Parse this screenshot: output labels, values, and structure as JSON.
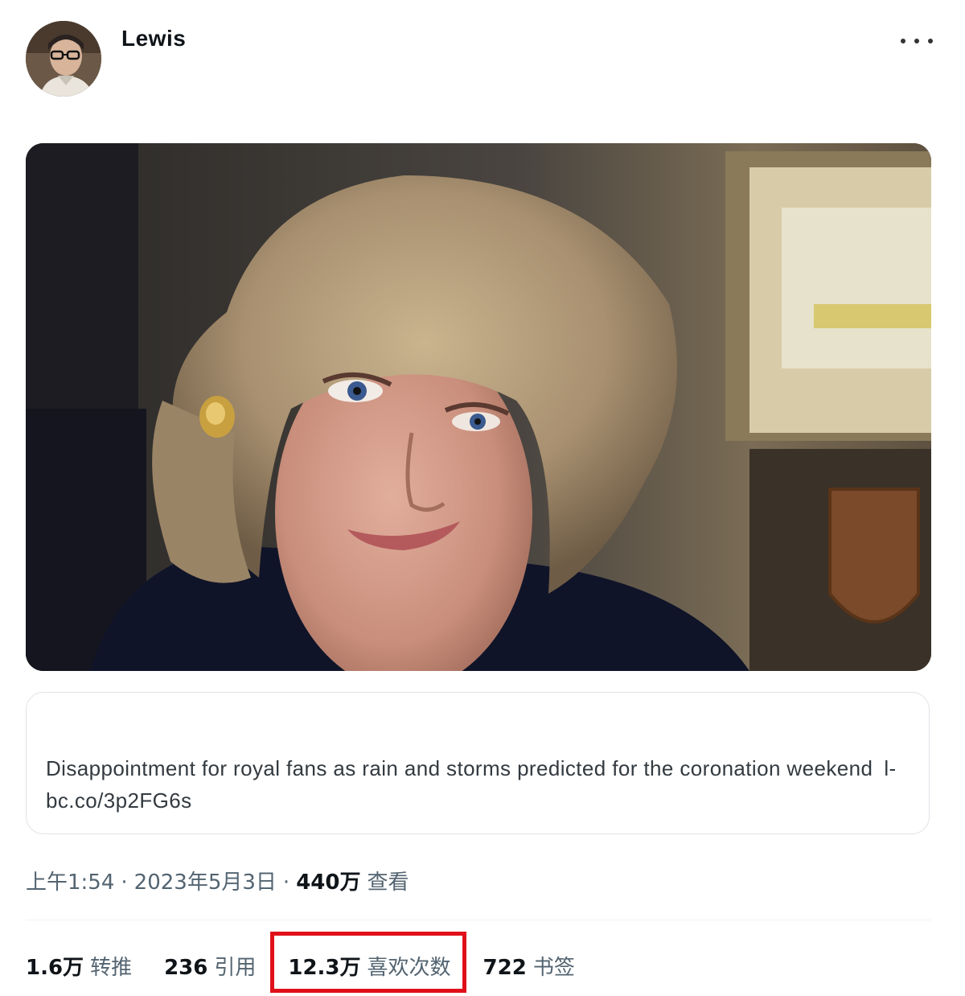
{
  "header": {
    "username": "Lewis",
    "more_icon": "more-horizontal-icon"
  },
  "media": {
    "icon": "photo-image"
  },
  "card": {
    "text": "Disappointment for royal fans as rain and storms predicted for the coronation weekend",
    "link": "l-bc.co/3p2FG6s"
  },
  "meta": {
    "time": "上午1:54",
    "sep1": "·",
    "date": "2023年5月3日",
    "sep2": "·",
    "views_count": "440万",
    "views_label": "查看"
  },
  "stats": {
    "retweets_count": "1.6万",
    "retweets_label": "转推",
    "quotes_count": "236",
    "quotes_label": "引用",
    "likes_count": "12.3万",
    "likes_label": "喜欢次数",
    "bookmarks_count": "722",
    "bookmarks_label": "书签"
  },
  "colors": {
    "highlight_box": "#e0101a",
    "secondary_text": "#536471",
    "primary_text": "#0f1419",
    "card_border": "#dfe3e7"
  }
}
